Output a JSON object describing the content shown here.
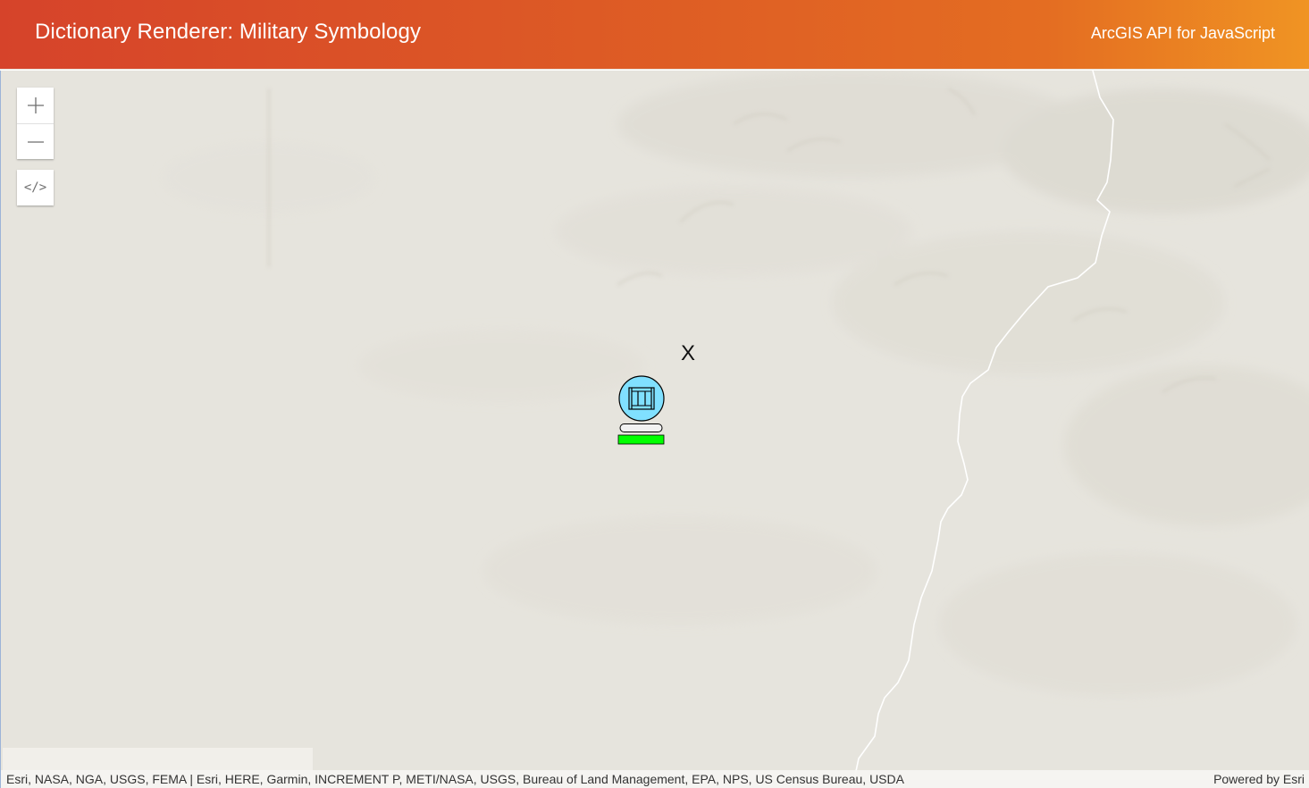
{
  "header": {
    "title": "Dictionary Renderer: Military Symbology",
    "link": "ArcGIS API for JavaScript"
  },
  "controls": {
    "zoom_in_icon": "plus-icon",
    "zoom_out_icon": "minus-icon",
    "code_label": "</>"
  },
  "map": {
    "symbol_label": "X",
    "symbol_icon": "military-unit-symbol",
    "symbol_fill": "#80e0ff",
    "symbol_status_color": "#00ff00"
  },
  "attribution": {
    "sources": "Esri, NASA, NGA, USGS, FEMA | Esri, HERE, Garmin, INCREMENT P, METI/NASA, USGS, Bureau of Land Management, EPA, NPS, US Census Bureau, USDA",
    "powered_by": "Powered by Esri"
  },
  "colors": {
    "header_gradient_start": "#d6432a",
    "header_gradient_end": "#f09423",
    "basemap": "#e6e4dd"
  }
}
